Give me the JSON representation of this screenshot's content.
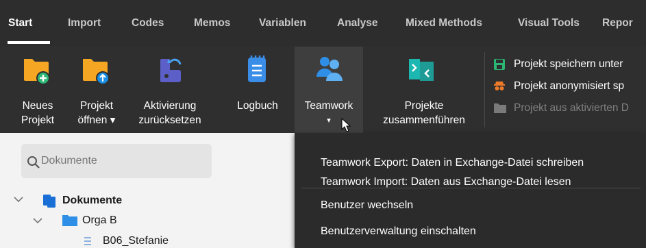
{
  "tabs": [
    {
      "label": "Start",
      "active": true
    },
    {
      "label": "Import"
    },
    {
      "label": "Codes"
    },
    {
      "label": "Memos"
    },
    {
      "label": "Variablen"
    },
    {
      "label": "Analyse"
    },
    {
      "label": "Mixed Methods"
    },
    {
      "label": "Visual Tools"
    },
    {
      "label": "Repor"
    }
  ],
  "ribbon": {
    "new_project": {
      "line1": "Neues",
      "line2": "Projekt",
      "icon": "folder-plus-icon"
    },
    "open_project": {
      "line1": "Projekt",
      "line2": "öffnen ▾",
      "icon": "folder-upload-icon"
    },
    "reset_activation": {
      "line1": "Aktivierung",
      "line2": "zurücksetzen",
      "icon": "reset-activation-icon"
    },
    "logbook": {
      "label": "Logbuch",
      "icon": "notepad-icon"
    },
    "teamwork": {
      "label": "Teamwork",
      "arrow": "▾",
      "icon": "users-icon"
    },
    "merge": {
      "line1": "Projekte",
      "line2": "zusammenführen",
      "icon": "merge-icon"
    },
    "side": [
      {
        "label": "Projekt speichern unter",
        "icon": "save-icon",
        "disabled": false
      },
      {
        "label": "Projekt anonymisiert sp",
        "icon": "anonymous-icon",
        "disabled": false
      },
      {
        "label": "Projekt aus aktivierten D",
        "icon": "folder-icon",
        "disabled": true
      }
    ]
  },
  "document_pane": {
    "search_placeholder": "Dokumente",
    "tree": [
      {
        "label": "Dokumente",
        "bold": true
      },
      {
        "label": "Orga B"
      },
      {
        "label": "B06_Stefanie"
      }
    ]
  },
  "teamwork_menu": [
    {
      "label": "Teamwork Export: Daten in Exchange-Datei schreiben"
    },
    {
      "label": "Teamwork Import: Daten aus Exchange-Datei lesen"
    },
    {
      "label": "Benutzer wechseln"
    },
    {
      "label": "Benutzerverwaltung einschalten"
    }
  ],
  "colors": {
    "folder": "#f5a623",
    "green_badge": "#2bb673",
    "blue_badge": "#1a8fe3",
    "accent_blue": "#2f8fe6",
    "teal": "#1bb7b0",
    "logbook_blue": "#3b8ee8",
    "purple": "#5b5fc7"
  }
}
